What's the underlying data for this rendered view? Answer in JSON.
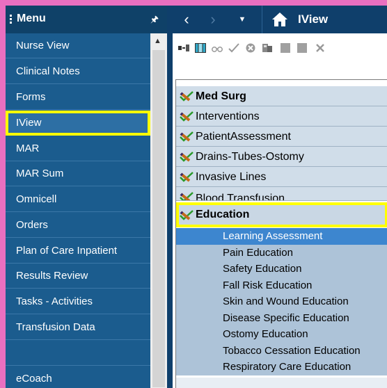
{
  "menu": {
    "title": "Menu",
    "items": [
      {
        "label": "Nurse View"
      },
      {
        "label": "Clinical Notes"
      },
      {
        "label": "Forms"
      },
      {
        "label": "IView",
        "active": true
      },
      {
        "label": "MAR"
      },
      {
        "label": "MAR Sum"
      },
      {
        "label": "Omnicell"
      },
      {
        "label": "Orders"
      },
      {
        "label": "Plan of Care Inpatient"
      },
      {
        "label": "Results Review"
      },
      {
        "label": "Tasks - Activities"
      },
      {
        "label": "Transfusion Data"
      },
      {
        "label": ""
      },
      {
        "label": "eCoach"
      }
    ]
  },
  "nav": {
    "title": "IView",
    "icons": [
      "back-icon",
      "forward-icon",
      "dropdown-icon",
      "home-icon"
    ]
  },
  "toolbar": {
    "icons": [
      "flowsheet-icon",
      "table-icon",
      "glasses-icon",
      "checkmark-icon",
      "delete-icon",
      "print-icon",
      "square-icon",
      "square-icon",
      "close-icon"
    ]
  },
  "bands": [
    {
      "label": "Med Surg",
      "bold": true
    },
    {
      "label": "Interventions"
    },
    {
      "label": "PatientAssessment"
    },
    {
      "label": "Drains-Tubes-Ostomy"
    },
    {
      "label": "Invasive Lines"
    },
    {
      "label": "Blood Transfusion"
    },
    {
      "label": "Education",
      "bold": true
    }
  ],
  "sections": [
    {
      "label": "Learning Assessment",
      "selected": true
    },
    {
      "label": "Pain Education"
    },
    {
      "label": "Safety Education"
    },
    {
      "label": "Fall Risk Education"
    },
    {
      "label": "Skin and Wound Education"
    },
    {
      "label": "Disease Specific Education"
    },
    {
      "label": "Ostomy Education"
    },
    {
      "label": "Tobacco Cessation Education"
    },
    {
      "label": "Respiratory Care Education"
    }
  ],
  "colors": {
    "highlight": "#ffff00",
    "menu_bg": "#1b5c8e",
    "selected_row": "#3d86cf"
  }
}
